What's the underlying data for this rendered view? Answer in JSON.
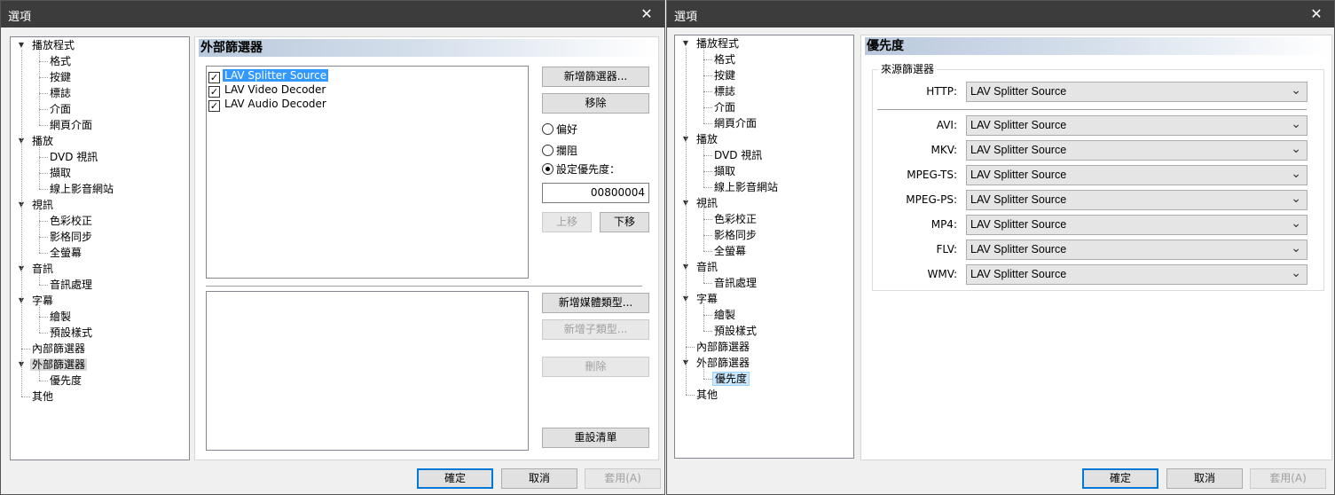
{
  "left_window": {
    "title": "選項",
    "close_glyph": "✕",
    "tree": [
      {
        "label": "播放程式",
        "level": 0,
        "expanded": true
      },
      {
        "label": "格式",
        "level": 1
      },
      {
        "label": "按鍵",
        "level": 1
      },
      {
        "label": "標誌",
        "level": 1
      },
      {
        "label": "介面",
        "level": 1
      },
      {
        "label": "網頁介面",
        "level": 1
      },
      {
        "label": "播放",
        "level": 0,
        "expanded": true
      },
      {
        "label": "DVD 視訊",
        "level": 1
      },
      {
        "label": "擷取",
        "level": 1
      },
      {
        "label": "線上影音網站",
        "level": 1
      },
      {
        "label": "視訊",
        "level": 0,
        "expanded": true
      },
      {
        "label": "色彩校正",
        "level": 1
      },
      {
        "label": "影格同步",
        "level": 1
      },
      {
        "label": "全螢幕",
        "level": 1
      },
      {
        "label": "音訊",
        "level": 0,
        "expanded": true
      },
      {
        "label": "音訊處理",
        "level": 1
      },
      {
        "label": "字幕",
        "level": 0,
        "expanded": true
      },
      {
        "label": "繪製",
        "level": 1
      },
      {
        "label": "預設樣式",
        "level": 1
      },
      {
        "label": "內部篩選器",
        "level": 0
      },
      {
        "label": "外部篩選器",
        "level": 0,
        "expanded": true,
        "selected": true
      },
      {
        "label": "優先度",
        "level": 1
      },
      {
        "label": "其他",
        "level": 0
      }
    ],
    "header": "外部篩選器",
    "filters": [
      {
        "label": "LAV Splitter Source",
        "checked": true,
        "selected": true
      },
      {
        "label": "LAV Video Decoder",
        "checked": true
      },
      {
        "label": "LAV Audio Decoder",
        "checked": true
      }
    ],
    "add_filter_btn": "新增篩選器...",
    "remove_btn": "移除",
    "radio_prefer": "偏好",
    "radio_block": "攔阻",
    "radio_priority": "設定優先度：",
    "priority_value": "00800004",
    "move_up_btn": "上移",
    "move_down_btn": "下移",
    "add_media_type_btn": "新增媒體類型...",
    "add_subtype_btn": "新增子類型...",
    "delete_btn": "刪除",
    "reset_list_btn": "重設清單",
    "ok_btn": "確定",
    "cancel_btn": "取消",
    "apply_btn": "套用(A)"
  },
  "right_window": {
    "title": "選項",
    "close_glyph": "✕",
    "header": "優先度",
    "group_title": "來源篩選器",
    "rows": [
      {
        "label": "HTTP:",
        "value": "LAV Splitter Source"
      },
      {
        "label": "AVI:",
        "value": "LAV Splitter Source"
      },
      {
        "label": "MKV:",
        "value": "LAV Splitter Source"
      },
      {
        "label": "MPEG-TS:",
        "value": "LAV Splitter Source"
      },
      {
        "label": "MPEG-PS:",
        "value": "LAV Splitter Source"
      },
      {
        "label": "MP4:",
        "value": "LAV Splitter Source"
      },
      {
        "label": "FLV:",
        "value": "LAV Splitter Source"
      },
      {
        "label": "WMV:",
        "value": "LAV Splitter Source"
      }
    ],
    "ok_btn": "確定",
    "cancel_btn": "取消",
    "apply_btn": "套用(A)"
  }
}
